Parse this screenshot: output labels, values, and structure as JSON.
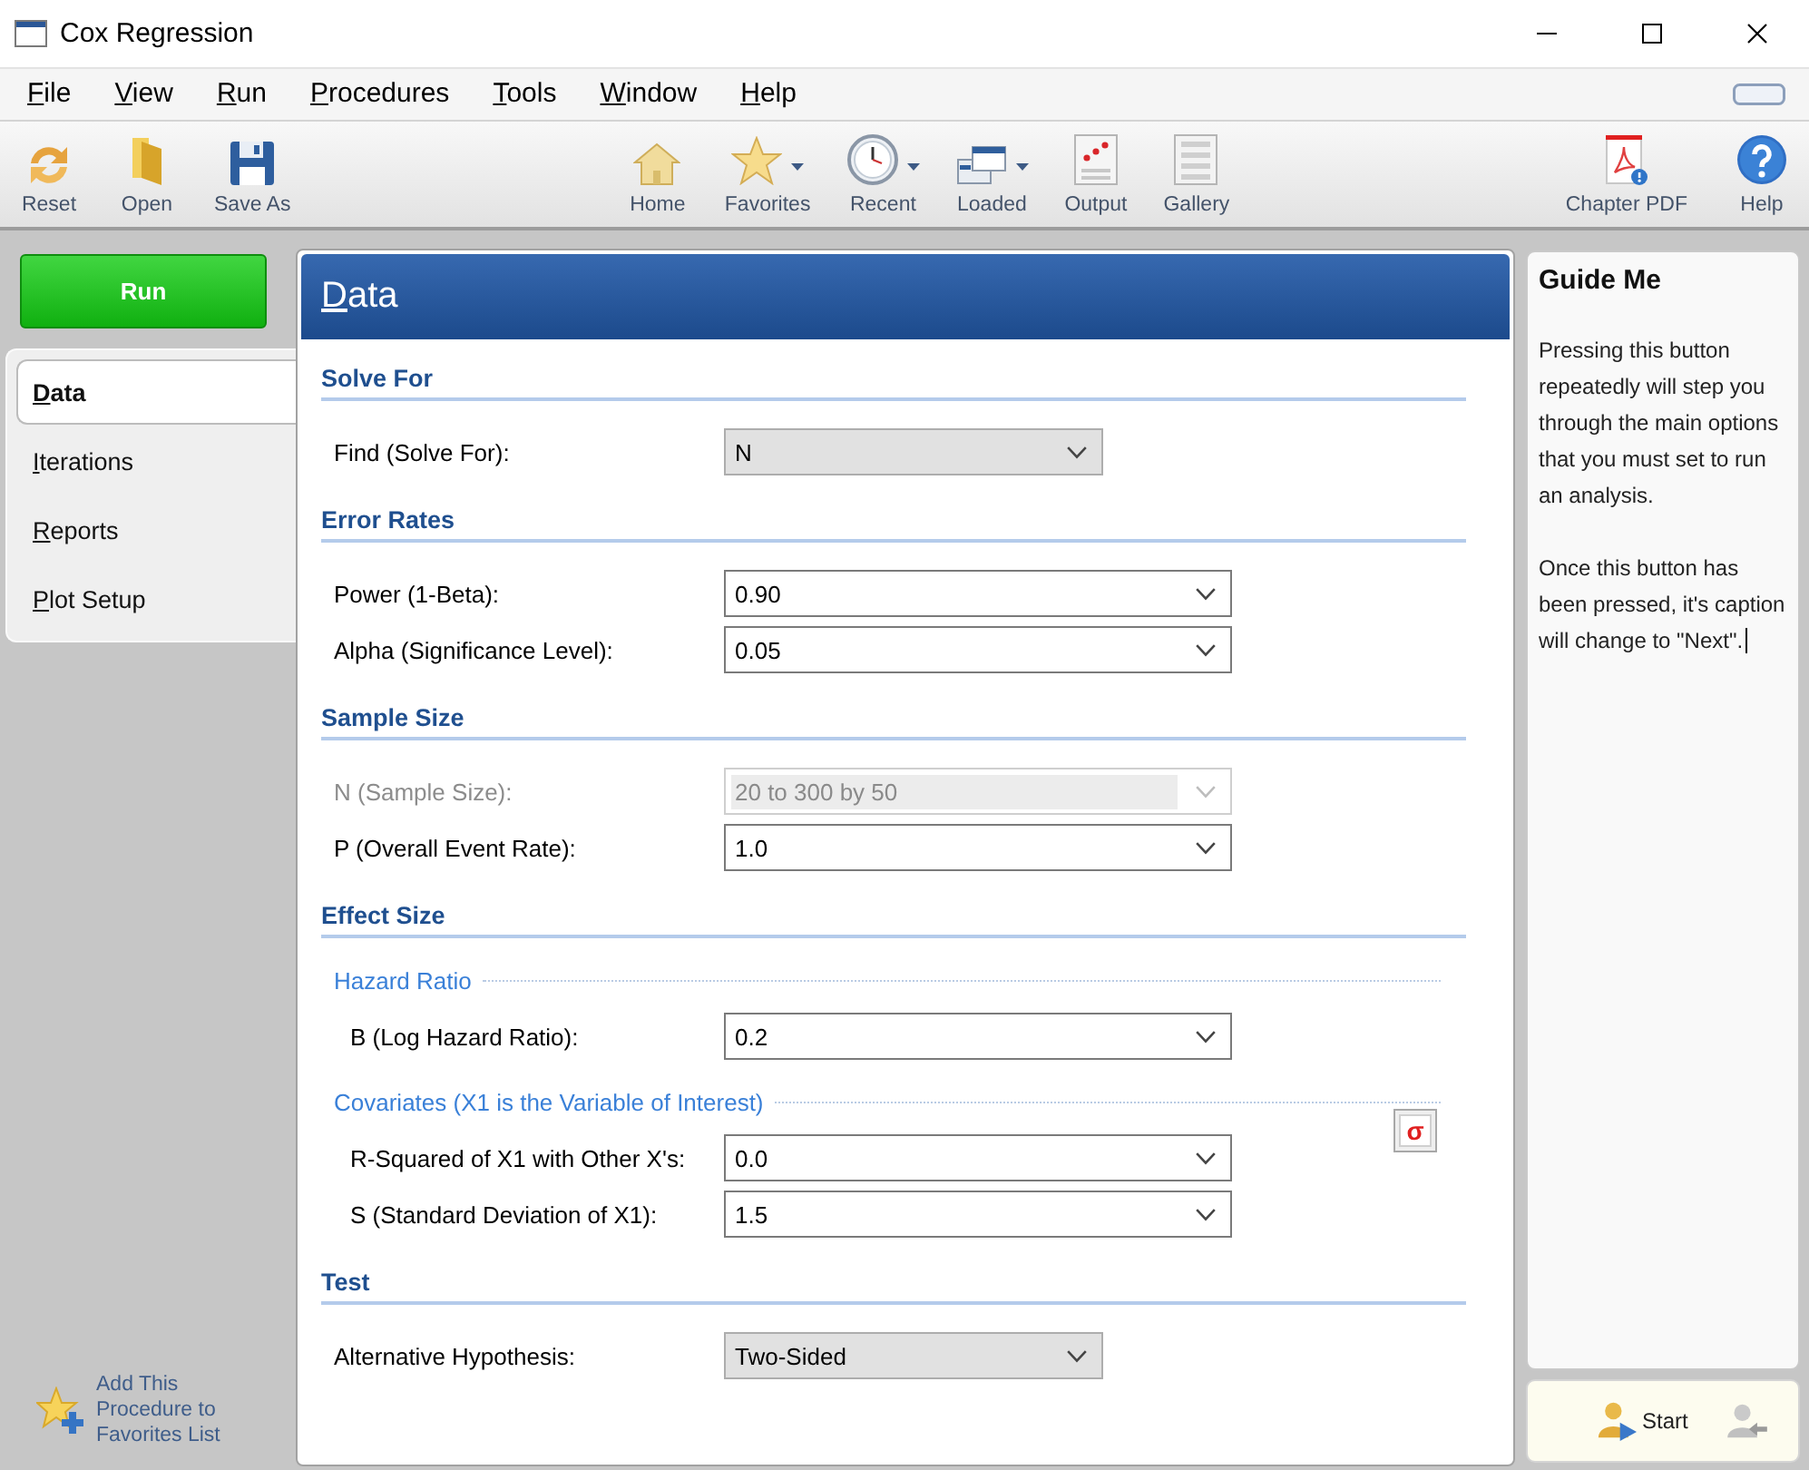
{
  "window": {
    "title": "Cox Regression"
  },
  "menu": [
    {
      "label": "File"
    },
    {
      "label": "View"
    },
    {
      "label": "Run"
    },
    {
      "label": "Procedures"
    },
    {
      "label": "Tools"
    },
    {
      "label": "Window"
    },
    {
      "label": "Help"
    }
  ],
  "toolbar": {
    "left": [
      {
        "label": "Reset",
        "dropdown": false
      },
      {
        "label": "Open",
        "dropdown": false
      },
      {
        "label": "Save As",
        "dropdown": false
      }
    ],
    "center": [
      {
        "label": "Home",
        "dropdown": false
      },
      {
        "label": "Favorites",
        "dropdown": true
      },
      {
        "label": "Recent",
        "dropdown": true
      },
      {
        "label": "Loaded",
        "dropdown": true
      },
      {
        "label": "Output",
        "dropdown": false
      },
      {
        "label": "Gallery",
        "dropdown": false
      }
    ],
    "right": [
      {
        "label": "Chapter PDF",
        "dropdown": false
      },
      {
        "label": "Help",
        "dropdown": false
      }
    ]
  },
  "run_button": {
    "label": "Run"
  },
  "side_tabs": [
    {
      "label": "Data",
      "selected": true
    },
    {
      "label": "Iterations",
      "selected": false
    },
    {
      "label": "Reports",
      "selected": false
    },
    {
      "label": "Plot Setup",
      "selected": false
    }
  ],
  "favorites_link": {
    "label": "Add This Procedure to Favorites List"
  },
  "panel": {
    "title": "Data",
    "sections": [
      {
        "title": "Solve For",
        "rows": [
          {
            "label": "Find (Solve For):",
            "value": "N",
            "kind": "select",
            "disabled": false
          }
        ]
      },
      {
        "title": "Error Rates",
        "rows": [
          {
            "label": "Power (1-Beta):",
            "value": "0.90",
            "kind": "combo",
            "disabled": false
          },
          {
            "label": "Alpha (Significance Level):",
            "value": "0.05",
            "kind": "combo",
            "disabled": false
          }
        ]
      },
      {
        "title": "Sample Size",
        "rows": [
          {
            "label": "N (Sample Size):",
            "value": "20 to 300 by 50",
            "kind": "combo",
            "disabled": true
          },
          {
            "label": "P (Overall Event Rate):",
            "value": "1.0",
            "kind": "combo",
            "disabled": false
          }
        ]
      },
      {
        "title": "Effect Size",
        "groups": [
          {
            "title": "Hazard Ratio",
            "rows": [
              {
                "label": "B (Log Hazard Ratio):",
                "value": "0.2",
                "kind": "combo",
                "disabled": false
              }
            ]
          },
          {
            "title": "Covariates (X1 is the Variable of Interest)",
            "button_symbol": "σ",
            "rows": [
              {
                "label": "R-Squared of X1 with Other X's:",
                "value": "0.0",
                "kind": "combo",
                "disabled": false
              },
              {
                "label": "S (Standard Deviation of X1):",
                "value": "1.5",
                "kind": "combo",
                "disabled": false
              }
            ]
          }
        ]
      },
      {
        "title": "Test",
        "rows": [
          {
            "label": "Alternative Hypothesis:",
            "value": "Two-Sided",
            "kind": "select",
            "disabled": false
          }
        ]
      }
    ]
  },
  "guide": {
    "title": "Guide Me",
    "paragraphs": [
      "Pressing this button repeatedly will step you through the main options that you must set to run an analysis.",
      "Once this button has been pressed, it's caption will change to \"Next\"."
    ],
    "cursor": true,
    "start_button": {
      "label": "Start"
    },
    "back_button": {
      "disabled": true
    }
  }
}
